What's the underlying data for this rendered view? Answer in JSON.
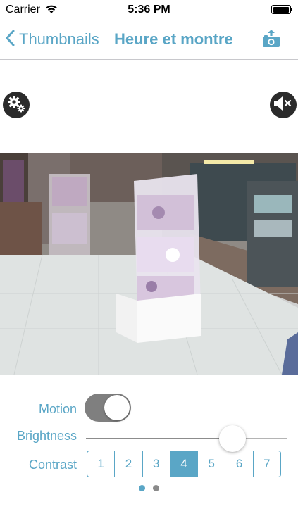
{
  "status_bar": {
    "carrier": "Carrier",
    "time": "5:36 PM",
    "icons": [
      "wifi-icon",
      "battery-icon"
    ]
  },
  "nav": {
    "back_label": "Thumbnails",
    "title": "Heure et montre",
    "icons": [
      "chevron-left-icon",
      "share-camera-icon"
    ],
    "accent_color": "#5aa6c6"
  },
  "camera_controls": {
    "icons": [
      "gear-icon",
      "speaker-muted-icon"
    ]
  },
  "controls": {
    "motion": {
      "label": "Motion",
      "enabled": true
    },
    "brightness": {
      "label": "Brightness",
      "value": 0.73
    },
    "contrast": {
      "label": "Contrast",
      "options": [
        "1",
        "2",
        "3",
        "4",
        "5",
        "6",
        "7"
      ],
      "selected": "4"
    }
  },
  "pager": {
    "pages": 2,
    "current": 1
  }
}
